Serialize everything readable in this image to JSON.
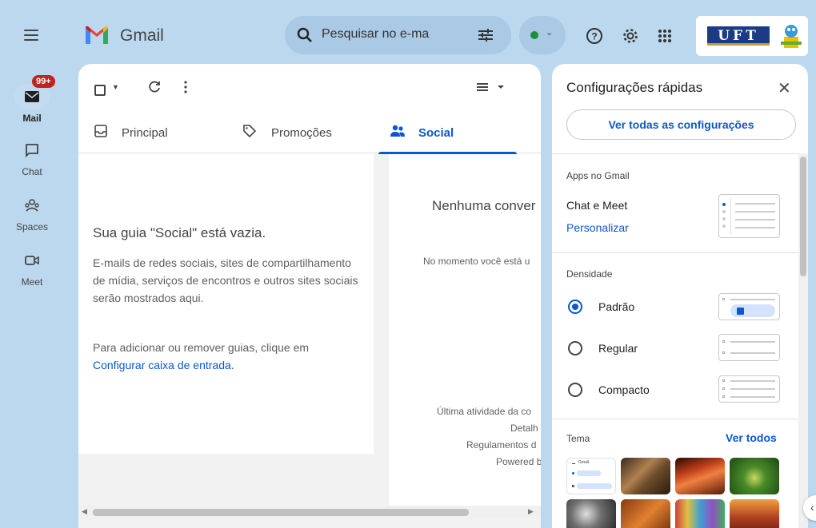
{
  "app": {
    "name": "Gmail"
  },
  "search": {
    "placeholder": "Pesquisar no e-mail"
  },
  "rail": [
    {
      "label": "Mail",
      "badge": "99+"
    },
    {
      "label": "Chat"
    },
    {
      "label": "Spaces"
    },
    {
      "label": "Meet"
    }
  ],
  "tabs": [
    {
      "label": "Principal"
    },
    {
      "label": "Promoções"
    },
    {
      "label": "Social"
    }
  ],
  "empty_state": {
    "title": "Sua guia \"Social\" está vazia.",
    "description": "E-mails de redes sociais, sites de compartilhamento de mídia, serviços de encontros e outros sites sociais serão mostrados aqui.",
    "hint_prefix": "Para adicionar ou remover guias, clique em",
    "hint_link": "Configurar caixa de entrada."
  },
  "right_pane": {
    "title": "Nenhuma conver",
    "subtitle": "No momento você está u",
    "footer_activity": "Última atividade da co",
    "footer_details": "Detalh",
    "footer_policies": "Regulamentos d",
    "footer_powered": "Powered by"
  },
  "quick_settings": {
    "title": "Configurações rápidas",
    "all_settings_label": "Ver todas as configurações",
    "apps_section": "Apps no Gmail",
    "chat_meet_label": "Chat e Meet",
    "customize_link": "Personalizar",
    "density_section": "Densidade",
    "density_options": [
      {
        "label": "Padrão",
        "selected": true
      },
      {
        "label": "Regular",
        "selected": false
      },
      {
        "label": "Compacto",
        "selected": false
      }
    ],
    "theme_section": "Tema",
    "theme_link": "Ver todos",
    "preview_brand": "Gmail"
  },
  "colors": {
    "accent": "#0b57d0",
    "background": "#bcd8ee",
    "badge": "#c5221f"
  },
  "org_badge": {
    "text": "UFT"
  }
}
